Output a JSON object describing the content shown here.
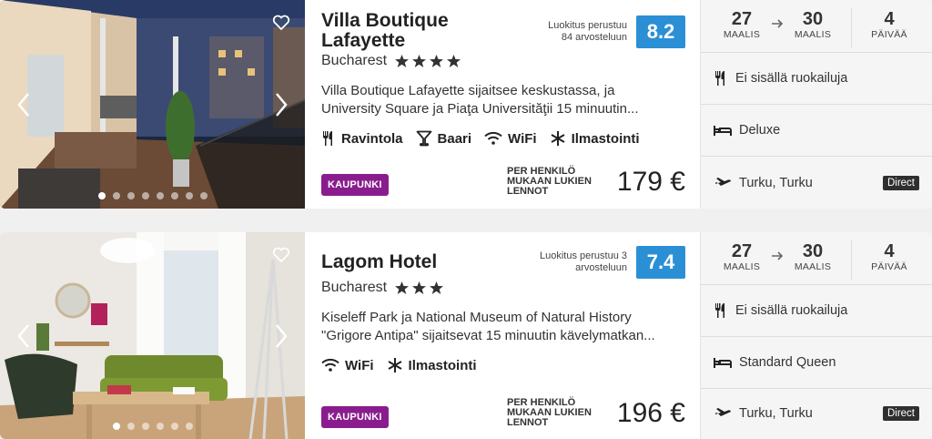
{
  "hotels": [
    {
      "name": "Villa Boutique Lafayette",
      "location": "Bucharest",
      "stars": 4,
      "rating_note_line1": "Luokitus perustuu",
      "rating_note_line2": "84 arvosteluun",
      "score": "8.2",
      "description_line1": "Villa Boutique Lafayette sijaitsee keskustassa, ja",
      "description_line2": "University Square ja Piaţa Universităţii 15 minuutin...",
      "amenities": [
        {
          "icon": "restaurant-icon",
          "label": "Ravintola"
        },
        {
          "icon": "bar-icon",
          "label": "Baari"
        },
        {
          "icon": "wifi-icon",
          "label": "WiFi"
        },
        {
          "icon": "snowflake-icon",
          "label": "Ilmastointi"
        }
      ],
      "badge": "KAUPUNKI",
      "per_person_line1": "PER HENKILÖ",
      "per_person_line2": "MUKAAN LUKIEN",
      "per_person_line3": "LENNOT",
      "price": "179 €",
      "photo_dots": 8,
      "photo_active_dot": 0,
      "check_in_day": "27",
      "check_in_month": "MAALIS",
      "check_out_day": "30",
      "check_out_month": "MAALIS",
      "nights": "4",
      "nights_label": "PÄIVÄÄ",
      "board": "Ei sisällä ruokailuja",
      "room": "Deluxe",
      "flight": "Turku, Turku",
      "flight_badge": "Direct"
    },
    {
      "name": "Lagom Hotel",
      "location": "Bucharest",
      "stars": 3,
      "rating_note_line1": "Luokitus perustuu 3",
      "rating_note_line2": "arvosteluun",
      "score": "7.4",
      "description_line1": "Kiseleff Park ja National Museum of Natural History",
      "description_line2": "\"Grigore Antipa\" sijaitsevat 15 minuutin kävelymatkan...",
      "amenities": [
        {
          "icon": "wifi-icon",
          "label": "WiFi"
        },
        {
          "icon": "snowflake-icon",
          "label": "Ilmastointi"
        }
      ],
      "badge": "KAUPUNKI",
      "per_person_line1": "PER HENKILÖ",
      "per_person_line2": "MUKAAN LUKIEN",
      "per_person_line3": "LENNOT",
      "price": "196 €",
      "photo_dots": 6,
      "photo_active_dot": 0,
      "check_in_day": "27",
      "check_in_month": "MAALIS",
      "check_out_day": "30",
      "check_out_month": "MAALIS",
      "nights": "4",
      "nights_label": "PÄIVÄÄ",
      "board": "Ei sisällä ruokailuja",
      "room": "Standard Queen",
      "flight": "Turku, Turku",
      "flight_badge": "Direct"
    }
  ],
  "colors": {
    "score_bg": "#2b8fd6",
    "badge_bg": "#8a1d8e",
    "star": "#333333",
    "direct_bg": "#2f2f2f"
  }
}
